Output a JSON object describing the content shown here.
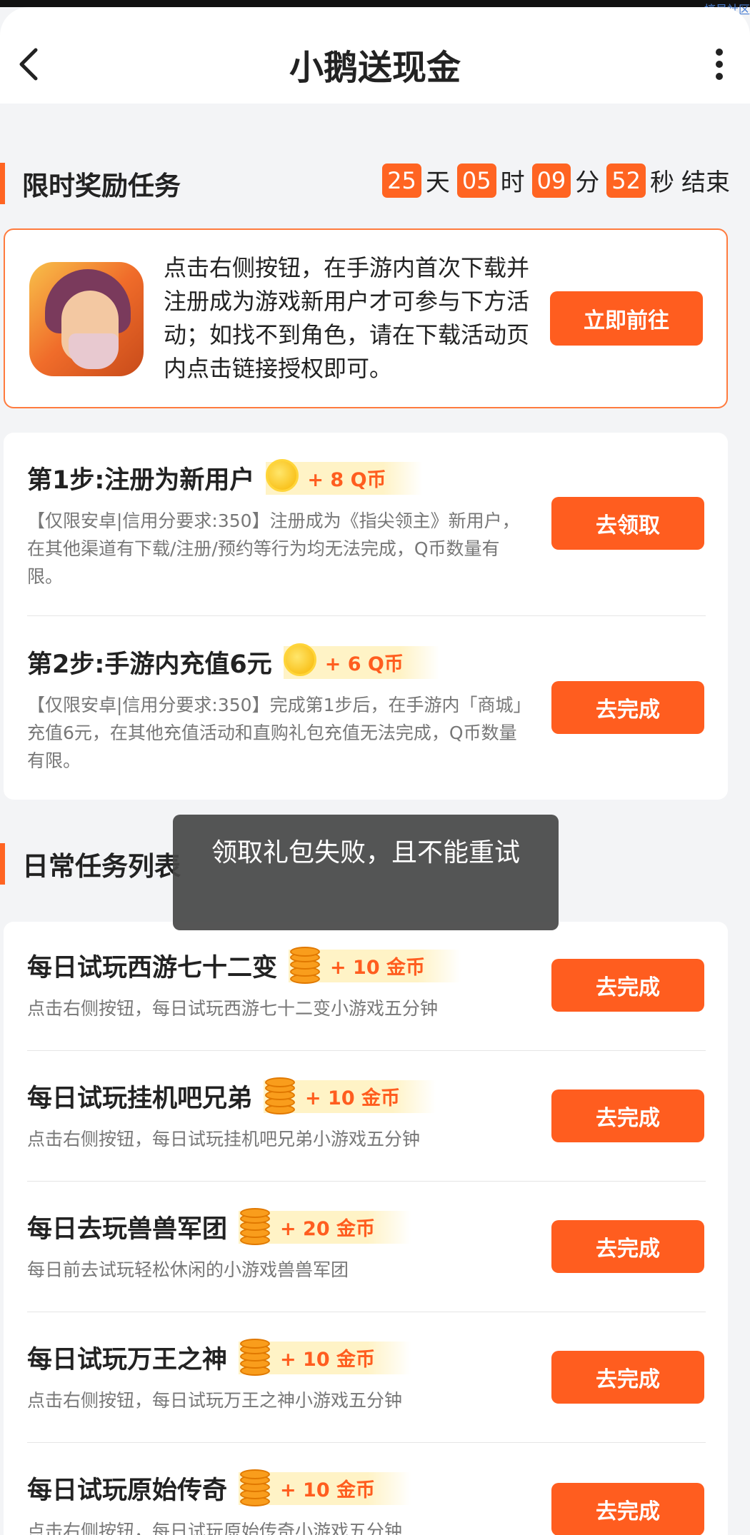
{
  "watermark": "搞星社区",
  "header": {
    "title": "小鹅送现金",
    "back_icon": "chevron-left-icon",
    "more_icon": "more-vertical-icon"
  },
  "limited": {
    "section_title": "限时奖励任务",
    "countdown": {
      "days": "25",
      "days_unit": "天",
      "hours": "05",
      "hours_unit": "时",
      "minutes": "09",
      "minutes_unit": "分",
      "seconds": "52",
      "seconds_unit": "秒",
      "suffix": "结束"
    },
    "game_card": {
      "description": "点击右侧按钮，在手游内首次下载并注册成为游戏新用户才可参与下方活动；如找不到角色，请在下载活动页内点击链接授权即可。",
      "button": "立即前往"
    },
    "steps": [
      {
        "title": "第1步:注册为新用户",
        "reward": "+ 8 Q币",
        "coin": "q-coin-icon",
        "desc": "【仅限安卓|信用分要求:350】注册成为《指尖领主》新用户，在其他渠道有下载/注册/预约等行为均无法完成，Q币数量有限。",
        "button": "去领取"
      },
      {
        "title": "第2步:手游内充值6元",
        "reward": "+ 6 Q币",
        "coin": "q-coin-icon",
        "desc": "【仅限安卓|信用分要求:350】完成第1步后，在手游内「商城」充值6元，在其他充值活动和直购礼包充值无法完成，Q币数量有限。",
        "button": "去完成"
      }
    ]
  },
  "daily": {
    "section_title": "日常任务列表",
    "tasks": [
      {
        "title": "每日试玩西游七十二变",
        "reward": "+ 10 金币",
        "desc": "点击右侧按钮，每日试玩西游七十二变小游戏五分钟",
        "button": "去完成"
      },
      {
        "title": "每日试玩挂机吧兄弟",
        "reward": "+ 10 金币",
        "desc": "点击右侧按钮，每日试玩挂机吧兄弟小游戏五分钟",
        "button": "去完成"
      },
      {
        "title": "每日去玩兽兽军团",
        "reward": "+ 20 金币",
        "desc": "每日前去试玩轻松休闲的小游戏兽兽军团",
        "button": "去完成"
      },
      {
        "title": "每日试玩万王之神",
        "reward": "+ 10 金币",
        "desc": "点击右侧按钮，每日试玩万王之神小游戏五分钟",
        "button": "去完成"
      },
      {
        "title": "每日试玩原始传奇",
        "reward": "+ 10 金币",
        "desc": "点击右侧按钮，每日试玩原始传奇小游戏五分钟",
        "button": "去完成"
      }
    ]
  },
  "toast": "领取礼包失败，且不能重试",
  "colors": {
    "accent": "#ff5d1f",
    "badge_bg": "#fff3c6",
    "toast_bg": "#464646"
  }
}
